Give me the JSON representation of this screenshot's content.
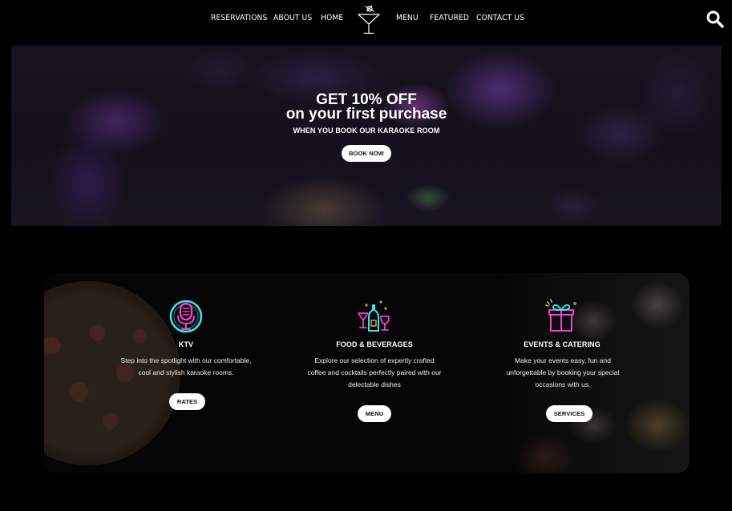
{
  "nav": {
    "links": [
      "RESERVATIONS",
      "ABOUT US",
      "HOME",
      "MENU",
      "FEATURED",
      "CONTACT US"
    ],
    "logo_icon": "martini-glass-icon",
    "search_icon": "search-icon"
  },
  "hero": {
    "line1": "GET 10% OFF",
    "line2": "on your first purchase",
    "line3": "WHEN YOU BOOK OUR KARAOKE ROOM",
    "button": "BOOK NOW"
  },
  "services": [
    {
      "icon": "microphone-icon",
      "title": "KTV",
      "desc_lines": [
        "Step into the spotlight with our comfortable,",
        "cool and stylish karaoke rooms."
      ],
      "button": "RATES"
    },
    {
      "icon": "bottle-glass-icon",
      "title": "FOOD & BEVERAGES",
      "desc_lines": [
        "Explore our selection of expertly crafted",
        "coffee and cocktails perfectly paired with our",
        "delectable dishes"
      ],
      "button": "MENU"
    },
    {
      "icon": "gift-box-icon",
      "title": "EVENTS & CATERING",
      "desc_lines": [
        "Make your events easy, fun and",
        "unforgettable by booking your special",
        "occasions with us."
      ],
      "button": "SERVICES"
    }
  ],
  "colors": {
    "background": "#000000",
    "neon_cyan": "#3fe8e6",
    "neon_magenta": "#ee3fd2",
    "neon_yellow": "#f2d24a",
    "button_bg": "#ffffff"
  }
}
